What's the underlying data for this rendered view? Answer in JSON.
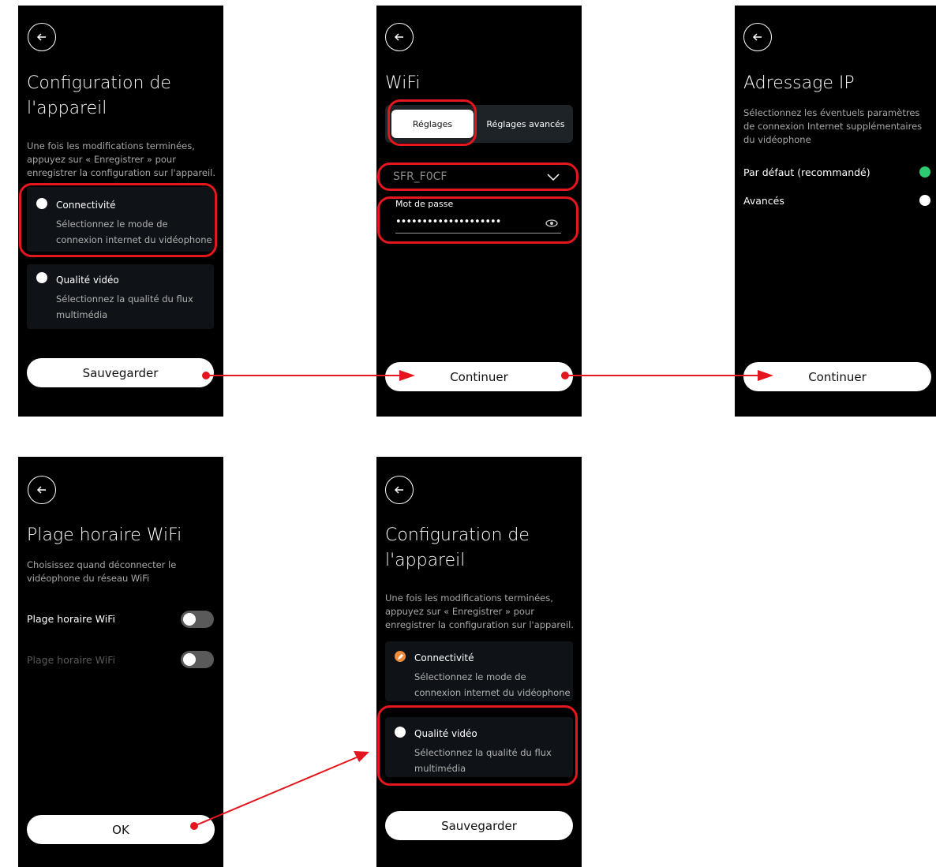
{
  "screen1": {
    "title": "Configuration de l'appareil",
    "description": "Une fois les modifications terminées, appuyez sur « Enregistrer » pour enregistrer la configuration sur l'appareil.",
    "card1": {
      "title": "Connectivité",
      "desc": "Sélectionnez le mode de connexion internet du vidéophone"
    },
    "card2": {
      "title": "Qualité vidéo",
      "desc": "Sélectionnez la qualité du flux multimédia"
    },
    "button": "Sauvegarder"
  },
  "screen2": {
    "title": "WiFi",
    "tab_active": "Réglages",
    "tab_inactive": "Réglages avancés",
    "network": "SFR_F0CF",
    "password_label": "Mot de passe",
    "password_value": "••••••••••••••••••••",
    "button": "Continuer"
  },
  "screen3": {
    "title": "Adressage IP",
    "description": "Sélectionnez les éventuels paramètres de connexion Internet supplémentaires du vidéophone",
    "option1": "Par défaut (recommandé)",
    "option2": "Avancés",
    "button": "Continuer"
  },
  "screen4": {
    "title": "Plage horaire WiFi",
    "description": "Choisissez quand déconnecter le vidéophone du réseau WiFi",
    "row1": "Plage horaire WiFi",
    "row2": "Plage horaire WiFi",
    "button": "OK"
  },
  "screen5": {
    "title": "Configuration de l'appareil",
    "description": "Une fois les modifications terminées, appuyez sur « Enregistrer » pour enregistrer la configuration sur l'appareil.",
    "card1": {
      "title": "Connectivité",
      "desc": "Sélectionnez le mode de connexion internet du vidéophone"
    },
    "card2": {
      "title": "Qualité vidéo",
      "desc": "Sélectionnez la qualité du flux multimédia"
    },
    "button": "Sauvegarder"
  },
  "colors": {
    "highlight": "#e4161e",
    "selected_radio": "#2ecc71",
    "done_icon": "#f08a3c",
    "screen_bg": "#000000"
  },
  "icons": [
    "back-arrow-icon",
    "chevron-down-icon",
    "eye-icon",
    "pencil-icon"
  ]
}
